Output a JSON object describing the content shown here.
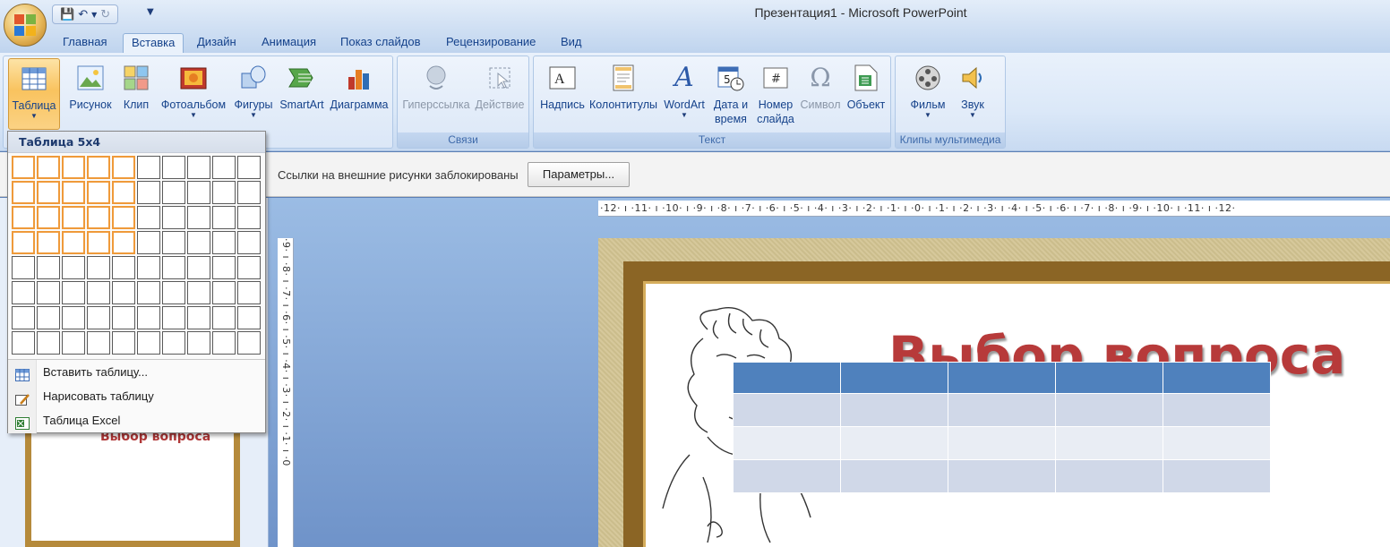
{
  "window": {
    "title": "Презентация1 - Microsoft PowerPoint"
  },
  "quick_access": {
    "save_icon": "save-icon",
    "undo_icon": "undo-icon",
    "redo_icon": "redo-icon",
    "customize_icon": "customize-icon"
  },
  "tabs": [
    {
      "label": "Главная"
    },
    {
      "label": "Вставка",
      "active": true
    },
    {
      "label": "Дизайн"
    },
    {
      "label": "Анимация"
    },
    {
      "label": "Показ слайдов"
    },
    {
      "label": "Рецензирование"
    },
    {
      "label": "Вид"
    }
  ],
  "ribbon": {
    "buttons": {
      "table": "Таблица",
      "picture": "Рисунок",
      "clip": "Клип",
      "photo_album": "Фотоальбом",
      "shapes": "Фигуры",
      "smartart": "SmartArt",
      "chart": "Диаграмма",
      "hyperlink": "Гиперссылка",
      "action": "Действие",
      "textbox": "Надпись",
      "header_footer": "Колонтитулы",
      "wordart": "WordArt",
      "date_line1": "Дата и",
      "date_line2": "время",
      "slide_num_line1": "Номер",
      "slide_num_line2": "слайда",
      "symbol": "Символ",
      "object": "Объект",
      "movie": "Фильм",
      "sound": "Звук"
    },
    "groups": {
      "links": "Связи",
      "text": "Текст",
      "media": "Клипы мультимедиа"
    }
  },
  "message_bar": {
    "text": "Ссылки на внешние рисунки заблокированы",
    "button": "Параметры..."
  },
  "table_dropdown": {
    "header": "Таблица 5x4",
    "grid_cols": 10,
    "grid_rows": 8,
    "selected_cols": 5,
    "selected_rows": 4,
    "items": {
      "insert": "Вставить таблицу...",
      "draw": "Нарисовать таблицу",
      "excel": "Таблица Excel"
    }
  },
  "rulers": {
    "horizontal": "·12· ı ·11· ı ·10· ı ·9· ı ·8· ı ·7· ı ·6· ı ·5· ı ·4· ı ·3· ı ·2· ı ·1· ı ·0· ı ·1· ı ·2· ı ·3· ı ·4· ı ·5· ı ·6· ı ·7· ı ·8· ı ·9· ı ·10· ı ·11· ı ·12·",
    "vertical": "·9· ı ·8· ı ·7· ı ·6· ı ·5· ı ·4· ı ·3· ı ·2· ı ·1· ı ·0"
  },
  "slide": {
    "title": "Выбор вопроса",
    "table_rows": 4,
    "table_cols": 5
  },
  "thumbnail": {
    "title": "Выбор вопроса"
  },
  "colors": {
    "table_header": "#4f81bd",
    "title_red": "#b73a3a",
    "selection_orange": "#ef9a3a"
  }
}
